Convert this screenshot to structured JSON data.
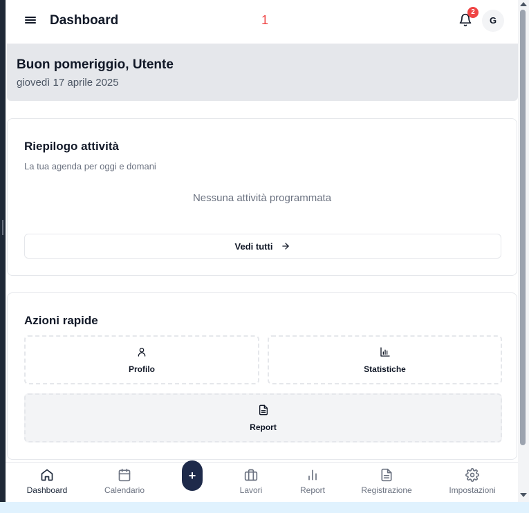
{
  "header": {
    "title": "Dashboard",
    "counter": "1",
    "notification_count": "2",
    "avatar_initial": "G"
  },
  "greeting": {
    "title": "Buon pomeriggio, Utente",
    "date": "giovedì 17 aprile 2025"
  },
  "activities": {
    "title": "Riepilogo attività",
    "subtitle": "La tua agenda per oggi e domani",
    "empty": "Nessuna attività programmata",
    "see_all": "Vedi tutti"
  },
  "quick_actions": {
    "title": "Azioni rapide",
    "items": [
      {
        "label": "Profilo",
        "icon": "user-icon"
      },
      {
        "label": "Statistiche",
        "icon": "bar-chart-icon"
      },
      {
        "label": "Report",
        "icon": "document-icon"
      }
    ]
  },
  "bottom_nav": {
    "items": [
      {
        "label": "Dashboard",
        "icon": "home-icon",
        "active": true
      },
      {
        "label": "Calendario",
        "icon": "calendar-icon"
      },
      {
        "label": "Lavori",
        "icon": "briefcase-icon"
      },
      {
        "label": "Report",
        "icon": "bar-chart-icon"
      },
      {
        "label": "Registrazione",
        "icon": "document-icon"
      },
      {
        "label": "Impostazioni",
        "icon": "gear-icon"
      }
    ],
    "fab_label": "+"
  },
  "colors": {
    "accent": "#1e2a4a",
    "badge": "#ef4444",
    "greeting_bg": "#e5e7eb"
  }
}
